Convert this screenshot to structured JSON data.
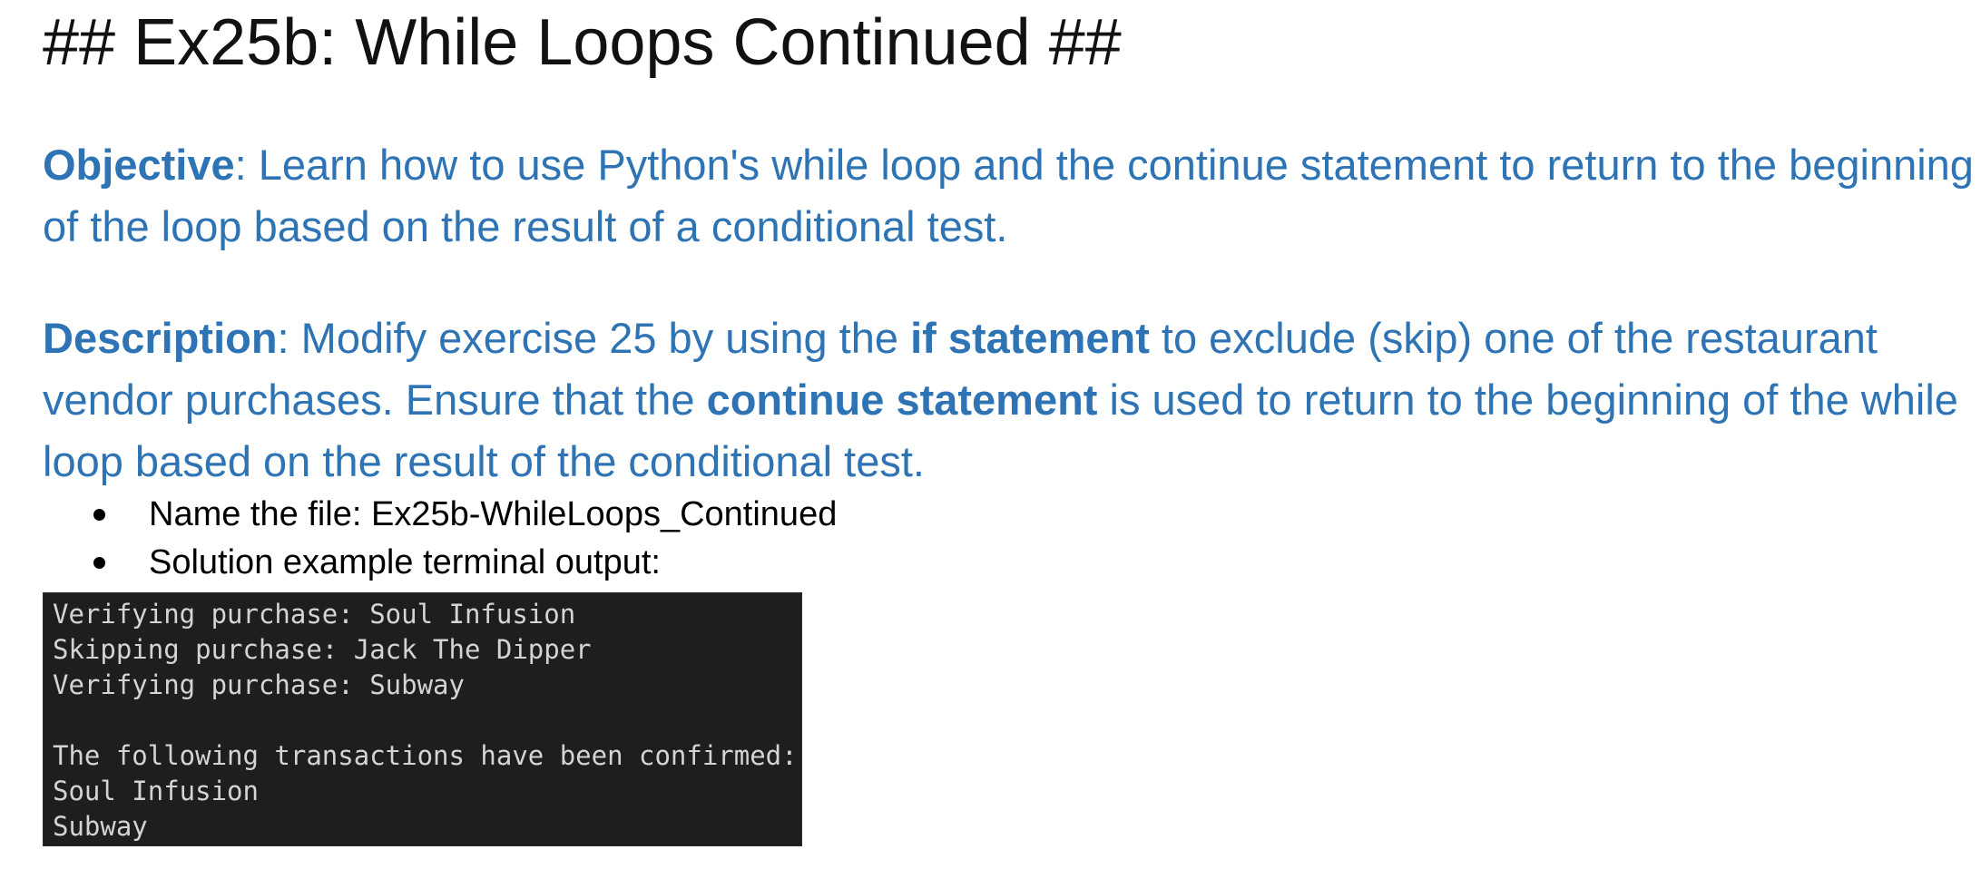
{
  "title": "## Ex25b: While Loops Continued ##",
  "objective": {
    "label": "Objective",
    "text": ": Learn how to use Python's while loop and the continue statement to return to the beginning of the loop based on the result of a conditional test."
  },
  "description": {
    "label": "Description",
    "part1": ": Modify exercise 25 by using the ",
    "bold1": "if statement",
    "part2": " to exclude (skip) one of the restaurant vendor purchases. Ensure that the ",
    "bold2": "continue statement",
    "part3": " is used to return to the beginning of the while loop based on the result of the conditional test."
  },
  "bullets": [
    "Name the file: Ex25b-WhileLoops_Continued",
    "Solution example terminal output:"
  ],
  "terminal": {
    "lines": [
      "Verifying purchase: Soul Infusion",
      "Skipping purchase: Jack The Dipper",
      "Verifying purchase: Subway",
      "",
      "The following transactions have been confirmed:",
      "Soul Infusion",
      "Subway"
    ]
  },
  "colors": {
    "heading_blue": "#2e74b5",
    "terminal_bg": "#1e1e1e",
    "terminal_text": "#d4d4d4"
  }
}
